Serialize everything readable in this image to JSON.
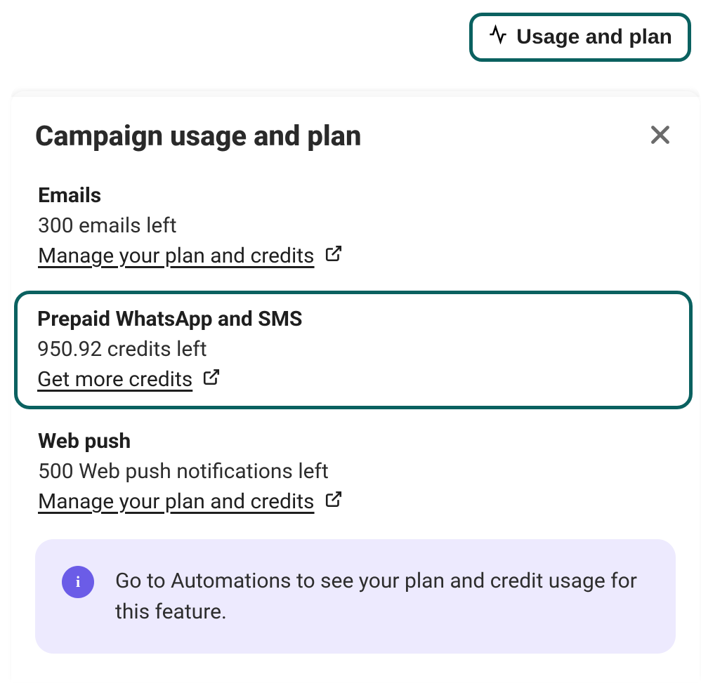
{
  "topButton": {
    "label": "Usage and plan"
  },
  "panel": {
    "title": "Campaign usage and plan",
    "sections": [
      {
        "title": "Emails",
        "value": "300 emails left",
        "linkText": "Manage your plan and credits"
      },
      {
        "title": "Prepaid WhatsApp and SMS",
        "value": "950.92 credits left",
        "linkText": "Get more credits"
      },
      {
        "title": "Web push",
        "value": "500 Web push notifications left",
        "linkText": "Manage your plan and credits"
      }
    ],
    "info": {
      "text": "Go to Automations to see your plan and credit usage for this feature."
    }
  }
}
